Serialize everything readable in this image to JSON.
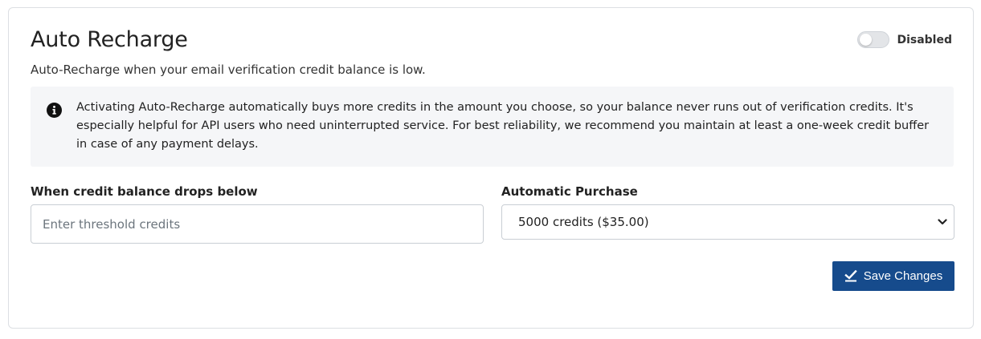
{
  "header": {
    "title": "Auto Recharge",
    "subtitle": "Auto-Recharge when your email verification credit balance is low."
  },
  "toggle": {
    "label": "Disabled",
    "state": "off"
  },
  "info": {
    "icon": "info-circle-icon",
    "text": "Activating Auto-Recharge automatically buys more credits in the amount you choose, so your balance never runs out of verification credits. It's especially helpful for API users who need uninterrupted service. For best reliability, we recommend you maintain at least a one-week credit buffer in case of any payment delays."
  },
  "threshold": {
    "label": "When credit balance drops below",
    "value": "",
    "placeholder": "Enter threshold credits"
  },
  "purchase": {
    "label": "Automatic Purchase",
    "selected": "5000 credits ($35.00)"
  },
  "save_button": {
    "label": "Save Changes",
    "icon": "check-icon"
  },
  "colors": {
    "primary_button": "#164b8c",
    "info_background": "#f5f6f8",
    "toggle_off": "#e3e5e8"
  }
}
